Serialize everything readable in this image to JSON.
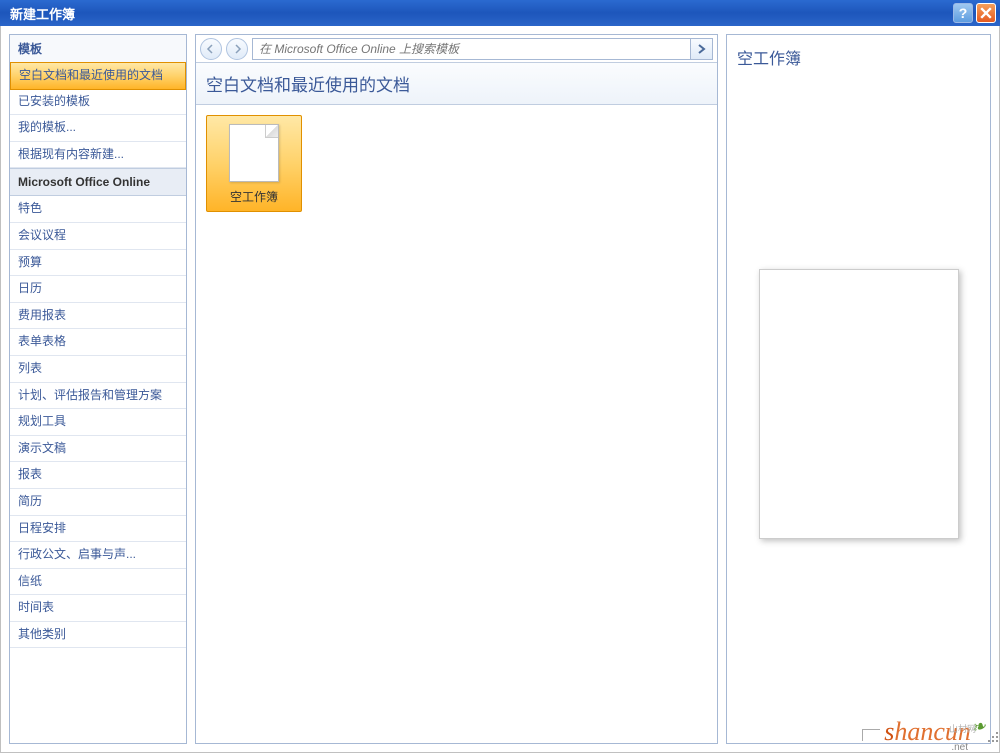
{
  "window": {
    "title": "新建工作簿"
  },
  "sidebar": {
    "header": "模板",
    "items": [
      {
        "label": "空白文档和最近使用的文档",
        "selected": true
      },
      {
        "label": "已安装的模板",
        "selected": false
      },
      {
        "label": "我的模板...",
        "selected": false
      },
      {
        "label": "根据现有内容新建...",
        "selected": false
      }
    ],
    "section_label": "Microsoft Office Online",
    "online_items": [
      {
        "label": "特色"
      },
      {
        "label": "会议议程"
      },
      {
        "label": "预算"
      },
      {
        "label": "日历"
      },
      {
        "label": "费用报表"
      },
      {
        "label": "表单表格"
      },
      {
        "label": "列表"
      },
      {
        "label": "计划、评估报告和管理方案"
      },
      {
        "label": "规划工具"
      },
      {
        "label": "演示文稿"
      },
      {
        "label": "报表"
      },
      {
        "label": "简历"
      },
      {
        "label": "日程安排"
      },
      {
        "label": "行政公文、启事与声..."
      },
      {
        "label": "信纸"
      },
      {
        "label": "时间表"
      },
      {
        "label": "其他类别"
      }
    ]
  },
  "center": {
    "search_placeholder": "在 Microsoft Office Online 上搜索模板",
    "section_title": "空白文档和最近使用的文档",
    "templates": [
      {
        "label": "空工作簿"
      }
    ]
  },
  "preview": {
    "title": "空工作簿"
  },
  "watermark": {
    "text_part1": "s",
    "text_part2": "hancun",
    "sub": ".net",
    "cn": "山村网"
  }
}
